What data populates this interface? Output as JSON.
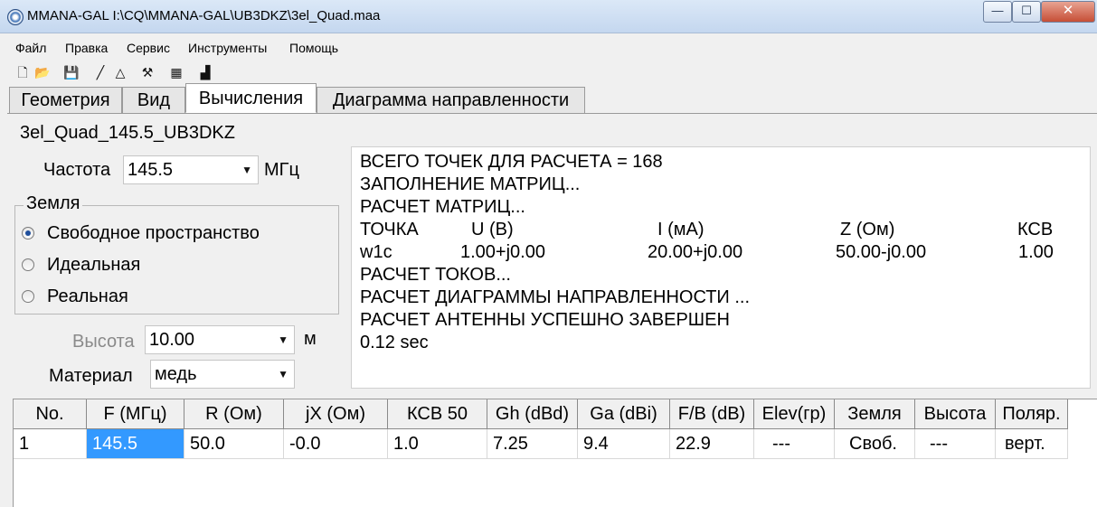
{
  "window": {
    "title": "MMANA-GAL I:\\CQ\\MMANA-GAL\\UB3DKZ\\3el_Quad.maa",
    "minimize_label": "—",
    "maximize_label": "☐",
    "close_label": "✕"
  },
  "menu": [
    "Файл",
    "Правка",
    "Сервис",
    "Инструменты",
    "Помощь"
  ],
  "toolbar_icons": [
    "new-file-icon",
    "open-folder-icon",
    "save-icon",
    "line-icon",
    "triangle-icon",
    "tools-icon",
    "calculator-icon",
    "chart-icon"
  ],
  "toolbar_glyphs": [
    "🗋",
    "📂",
    "💾",
    "╱",
    "△",
    "⚒",
    "▦",
    "▟"
  ],
  "tabs": [
    "Геометрия",
    "Вид",
    "Вычисления",
    "Диаграмма направленности"
  ],
  "active_tab": "Вычисления",
  "project_name": "3el_Quad_145.5_UB3DKZ",
  "frequency": {
    "label": "Частота",
    "value": "145.5",
    "unit": "МГц"
  },
  "ground": {
    "title": "Земля",
    "options": [
      "Свободное пространство",
      "Идеальная",
      "Реальная"
    ],
    "selected": "Свободное пространство"
  },
  "height": {
    "label": "Высота",
    "value": "10.00",
    "unit": "м"
  },
  "material": {
    "label": "Материал",
    "value": "медь"
  },
  "log": {
    "lines": [
      "ВСЕГО ТОЧЕК ДЛЯ РАСЧЕТА = 168",
      "ЗАПОЛНЕНИЕ МАТРИЦ...",
      "РАСЧЕТ МАТРИЦ..."
    ],
    "header": {
      "point": "ТОЧКА",
      "u": "U (В)",
      "i": "I (мА)",
      "z": "Z (Ом)",
      "swr": "КСВ"
    },
    "row": {
      "point": "w1c",
      "u": "1.00+j0.00",
      "i": "20.00+j0.00",
      "z": "50.00-j0.00",
      "swr": "1.00"
    },
    "lines_after": [
      "РАСЧЕТ ТОКОВ...",
      "РАСЧЕТ ДИАГРАММЫ НАПРАВЛЕННОСТИ ...",
      "РАСЧЕТ АНТЕННЫ УСПЕШНО ЗАВЕРШЕН",
      "0.12 sec"
    ]
  },
  "results": {
    "columns": [
      "No.",
      "F (МГц)",
      "R (Ом)",
      "jX (Ом)",
      "КСВ 50",
      "Gh (dBd)",
      "Ga (dBi)",
      "F/B (dB)",
      "Elev(гр)",
      "Земля",
      "Высота",
      "Поляр."
    ],
    "rows": [
      [
        "1",
        "145.5",
        "50.0",
        "-0.0",
        "1.0",
        "7.25",
        "9.4",
        "22.9",
        "---",
        "Своб.",
        "---",
        "верт."
      ]
    ]
  }
}
